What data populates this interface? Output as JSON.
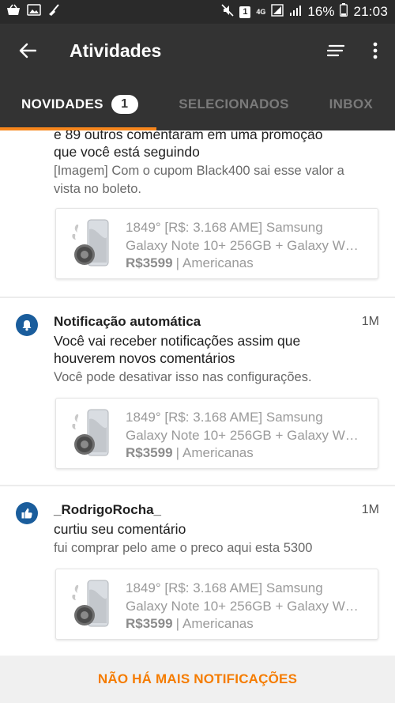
{
  "status_bar": {
    "battery": "16%",
    "time": "21:03",
    "notification_count": "1",
    "network": "4G",
    "icons": [
      "basket-icon",
      "image-notification-icon",
      "broom-icon",
      "mute-icon",
      "wifi-icon",
      "signal-icon",
      "battery-icon"
    ]
  },
  "app_bar": {
    "title": "Atividades",
    "icons": [
      "back-arrow-icon",
      "filter-icon",
      "more-vert-icon"
    ]
  },
  "tabs": [
    {
      "label": "NOVIDADES",
      "badge": "1",
      "active": true
    },
    {
      "label": "SELECIONADOS",
      "active": false
    },
    {
      "label": "INBOX",
      "active": false
    }
  ],
  "colors": {
    "accent": "#f7861c",
    "app_bar": "#333333",
    "icon_circle": "#1a5d9c",
    "footer_text": "#f57c00"
  },
  "notifications": [
    {
      "title": "",
      "time": "",
      "message_lines": [
        "e 89 outros comentaram em uma promoção",
        "que você está seguindo"
      ],
      "comment_lines": [
        "[Imagem] Com o cupom Black400 sai esse valor a",
        "vista no boleto."
      ],
      "deal": {
        "title_lines": [
          "1849° [R$: 3.168 AME] Samsung",
          "Galaxy Note 10+ 256GB + Galaxy W…"
        ],
        "price": "R$3599",
        "separator": "|",
        "store": "Americanas"
      }
    },
    {
      "icon": "bell-icon",
      "title": "Notificação automática",
      "time": "1M",
      "message_lines": [
        "Você vai receber notificações assim que",
        "houverem novos comentários"
      ],
      "comment_lines": [
        "Você pode desativar isso nas configurações."
      ],
      "deal": {
        "title_lines": [
          "1849° [R$: 3.168 AME] Samsung",
          "Galaxy Note 10+ 256GB + Galaxy W…"
        ],
        "price": "R$3599",
        "separator": "|",
        "store": "Americanas"
      }
    },
    {
      "icon": "thumbs-up-icon",
      "title": "_RodrigoRocha_",
      "time": "1M",
      "message_lines": [
        "curtiu seu comentário"
      ],
      "comment_lines": [
        "fui comprar pelo ame o preco aqui esta 5300"
      ],
      "deal": {
        "title_lines": [
          "1849° [R$: 3.168 AME] Samsung",
          "Galaxy Note 10+ 256GB + Galaxy W…"
        ],
        "price": "R$3599",
        "separator": "|",
        "store": "Americanas"
      }
    }
  ],
  "footer": {
    "label": "NÃO HÁ MAIS NOTIFICAÇÕES"
  }
}
